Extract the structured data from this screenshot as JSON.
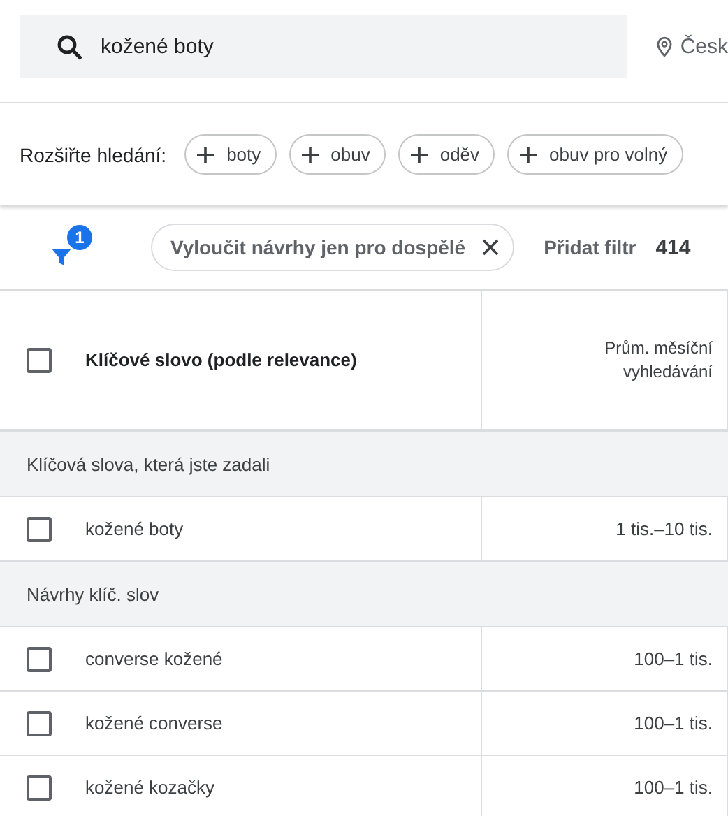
{
  "search": {
    "value": "kožené boty",
    "location": "Česk"
  },
  "broaden": {
    "label": "Rozšiřte hledání:",
    "chips": [
      "boty",
      "obuv",
      "oděv",
      "obuv pro volný"
    ]
  },
  "filters": {
    "count": "1",
    "chips": [
      "Vyloučit návrhy jen pro dospělé"
    ],
    "add_label": "Přidat filtr",
    "total": "414"
  },
  "table": {
    "columns": [
      "Klíčové slovo (podle relevance)",
      "Prům. měsíční vyhledávání"
    ],
    "header_checked": false,
    "rows": [
      {
        "kind": "group",
        "label": "Klíčová slova, která jste zadali"
      },
      {
        "kind": "row",
        "keyword": "kožené boty",
        "searches": "1 tis.–10 tis.",
        "checked": false
      },
      {
        "kind": "group",
        "label": "Návrhy klíč. slov"
      },
      {
        "kind": "row",
        "keyword": "converse kožené",
        "searches": "100–1 tis.",
        "checked": false
      },
      {
        "kind": "row",
        "keyword": "kožené converse",
        "searches": "100–1 tis.",
        "checked": false
      },
      {
        "kind": "row",
        "keyword": "kožené kozačky",
        "searches": "100–1 tis.",
        "checked": false
      }
    ]
  }
}
